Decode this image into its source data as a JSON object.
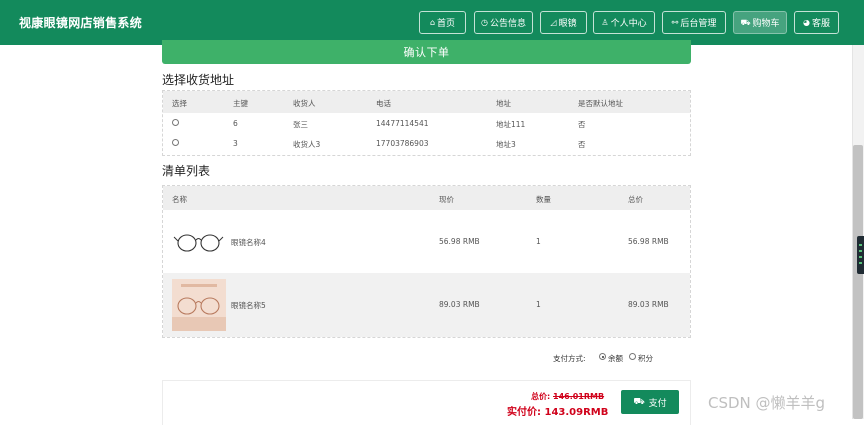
{
  "header": {
    "brand": "视康眼镜网店销售系统",
    "nav": [
      {
        "label": "首页",
        "icon": "home-icon",
        "glyph": "⌂"
      },
      {
        "label": "公告信息",
        "icon": "clock-icon",
        "glyph": "◷"
      },
      {
        "label": "眼镜",
        "icon": "tag-icon",
        "glyph": "◿"
      },
      {
        "label": "个人中心",
        "icon": "user-icon",
        "glyph": "♙"
      },
      {
        "label": "后台管理",
        "icon": "link-icon",
        "glyph": "⚯"
      },
      {
        "label": "购物车",
        "icon": "cart-icon",
        "glyph": "⛟",
        "active": true
      },
      {
        "label": "客服",
        "icon": "chat-icon",
        "glyph": "◕"
      }
    ]
  },
  "confirm_label": "确认下单",
  "address": {
    "title": "选择收货地址",
    "columns": [
      "选择",
      "主键",
      "收货人",
      "电话",
      "地址",
      "是否默认地址"
    ],
    "rows": [
      {
        "id": "6",
        "name": "张三",
        "phone": "14477114541",
        "address": "地址111",
        "default": "否"
      },
      {
        "id": "3",
        "name": "收货人3",
        "phone": "17703786903",
        "address": "地址3",
        "default": "否"
      }
    ]
  },
  "order": {
    "title": "清单列表",
    "columns": [
      "名称",
      "现价",
      "数量",
      "总价"
    ],
    "rows": [
      {
        "name": "眼镜名称4",
        "price": "56.98 RMB",
        "qty": "1",
        "total": "56.98 RMB"
      },
      {
        "name": "眼镜名称5",
        "price": "89.03 RMB",
        "qty": "1",
        "total": "89.03 RMB"
      }
    ]
  },
  "payment": {
    "label": "支付方式:",
    "options": [
      {
        "label": "余额",
        "checked": true
      },
      {
        "label": "积分",
        "checked": false
      }
    ]
  },
  "totals": {
    "original_label": "总价:",
    "original_value": "146.01RMB",
    "actual_label": "实付价:",
    "actual_value": "143.09RMB"
  },
  "pay_button": "支付",
  "watermark": "CSDN @懒羊羊g",
  "colors": {
    "primary": "#138a5c",
    "confirm": "#3eb169",
    "price_red": "#d0021b"
  }
}
